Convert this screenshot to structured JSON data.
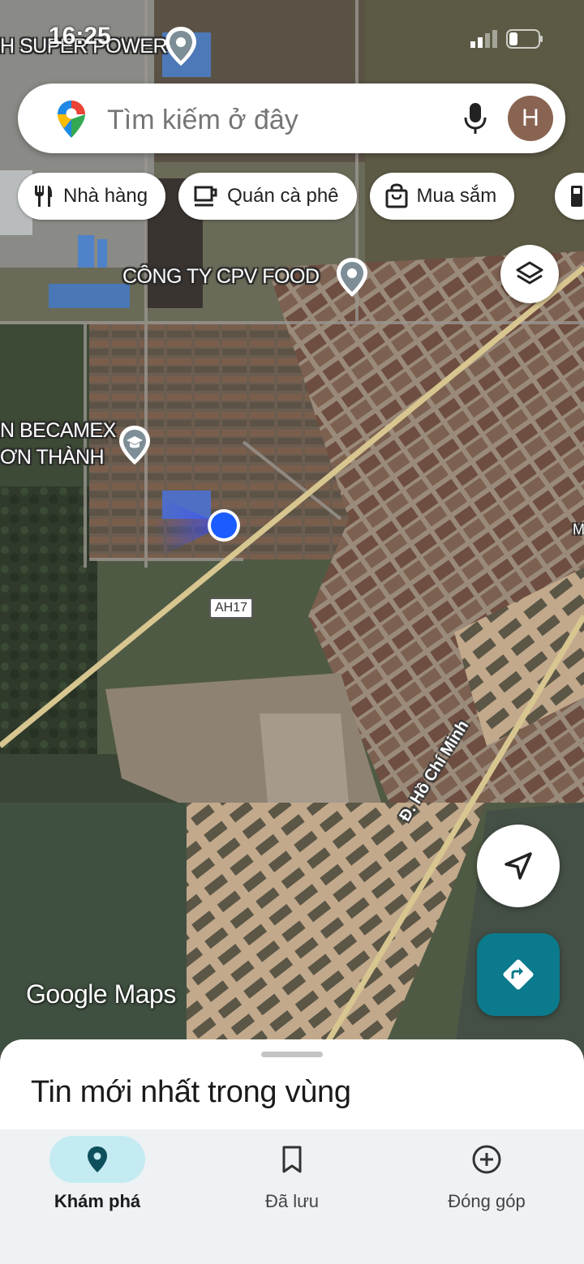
{
  "status_bar": {
    "time": "16:25"
  },
  "search": {
    "placeholder": "Tìm kiếm ở đây",
    "avatar_initial": "H"
  },
  "chips": [
    {
      "label": "Nhà hàng",
      "icon": "restaurant-icon"
    },
    {
      "label": "Quán cà phê",
      "icon": "coffee-icon"
    },
    {
      "label": "Mua sắm",
      "icon": "shopping-bag-icon"
    }
  ],
  "map": {
    "pois": [
      {
        "label": "H SUPER POWER"
      },
      {
        "label": "CÔNG TY CPV FOOD"
      },
      {
        "label_line1": "N BECAMEX",
        "label_line2": "ƠN THÀNH"
      }
    ],
    "road_shield": "AH17",
    "road_name": "Đ. Hồ Chí Minh",
    "edge_label": "M",
    "watermark": "Google Maps"
  },
  "sheet": {
    "title": "Tin mới nhất trong vùng"
  },
  "bottom_nav": [
    {
      "label": "Khám phá",
      "icon": "explore-pin-icon",
      "active": true
    },
    {
      "label": "Đã lưu",
      "icon": "bookmark-icon",
      "active": false
    },
    {
      "label": "Đóng góp",
      "icon": "add-circle-icon",
      "active": false
    }
  ],
  "colors": {
    "accent": "#0b7a8c",
    "nav_active_pill": "#c5ebf2",
    "location_dot": "#1a5cff"
  }
}
